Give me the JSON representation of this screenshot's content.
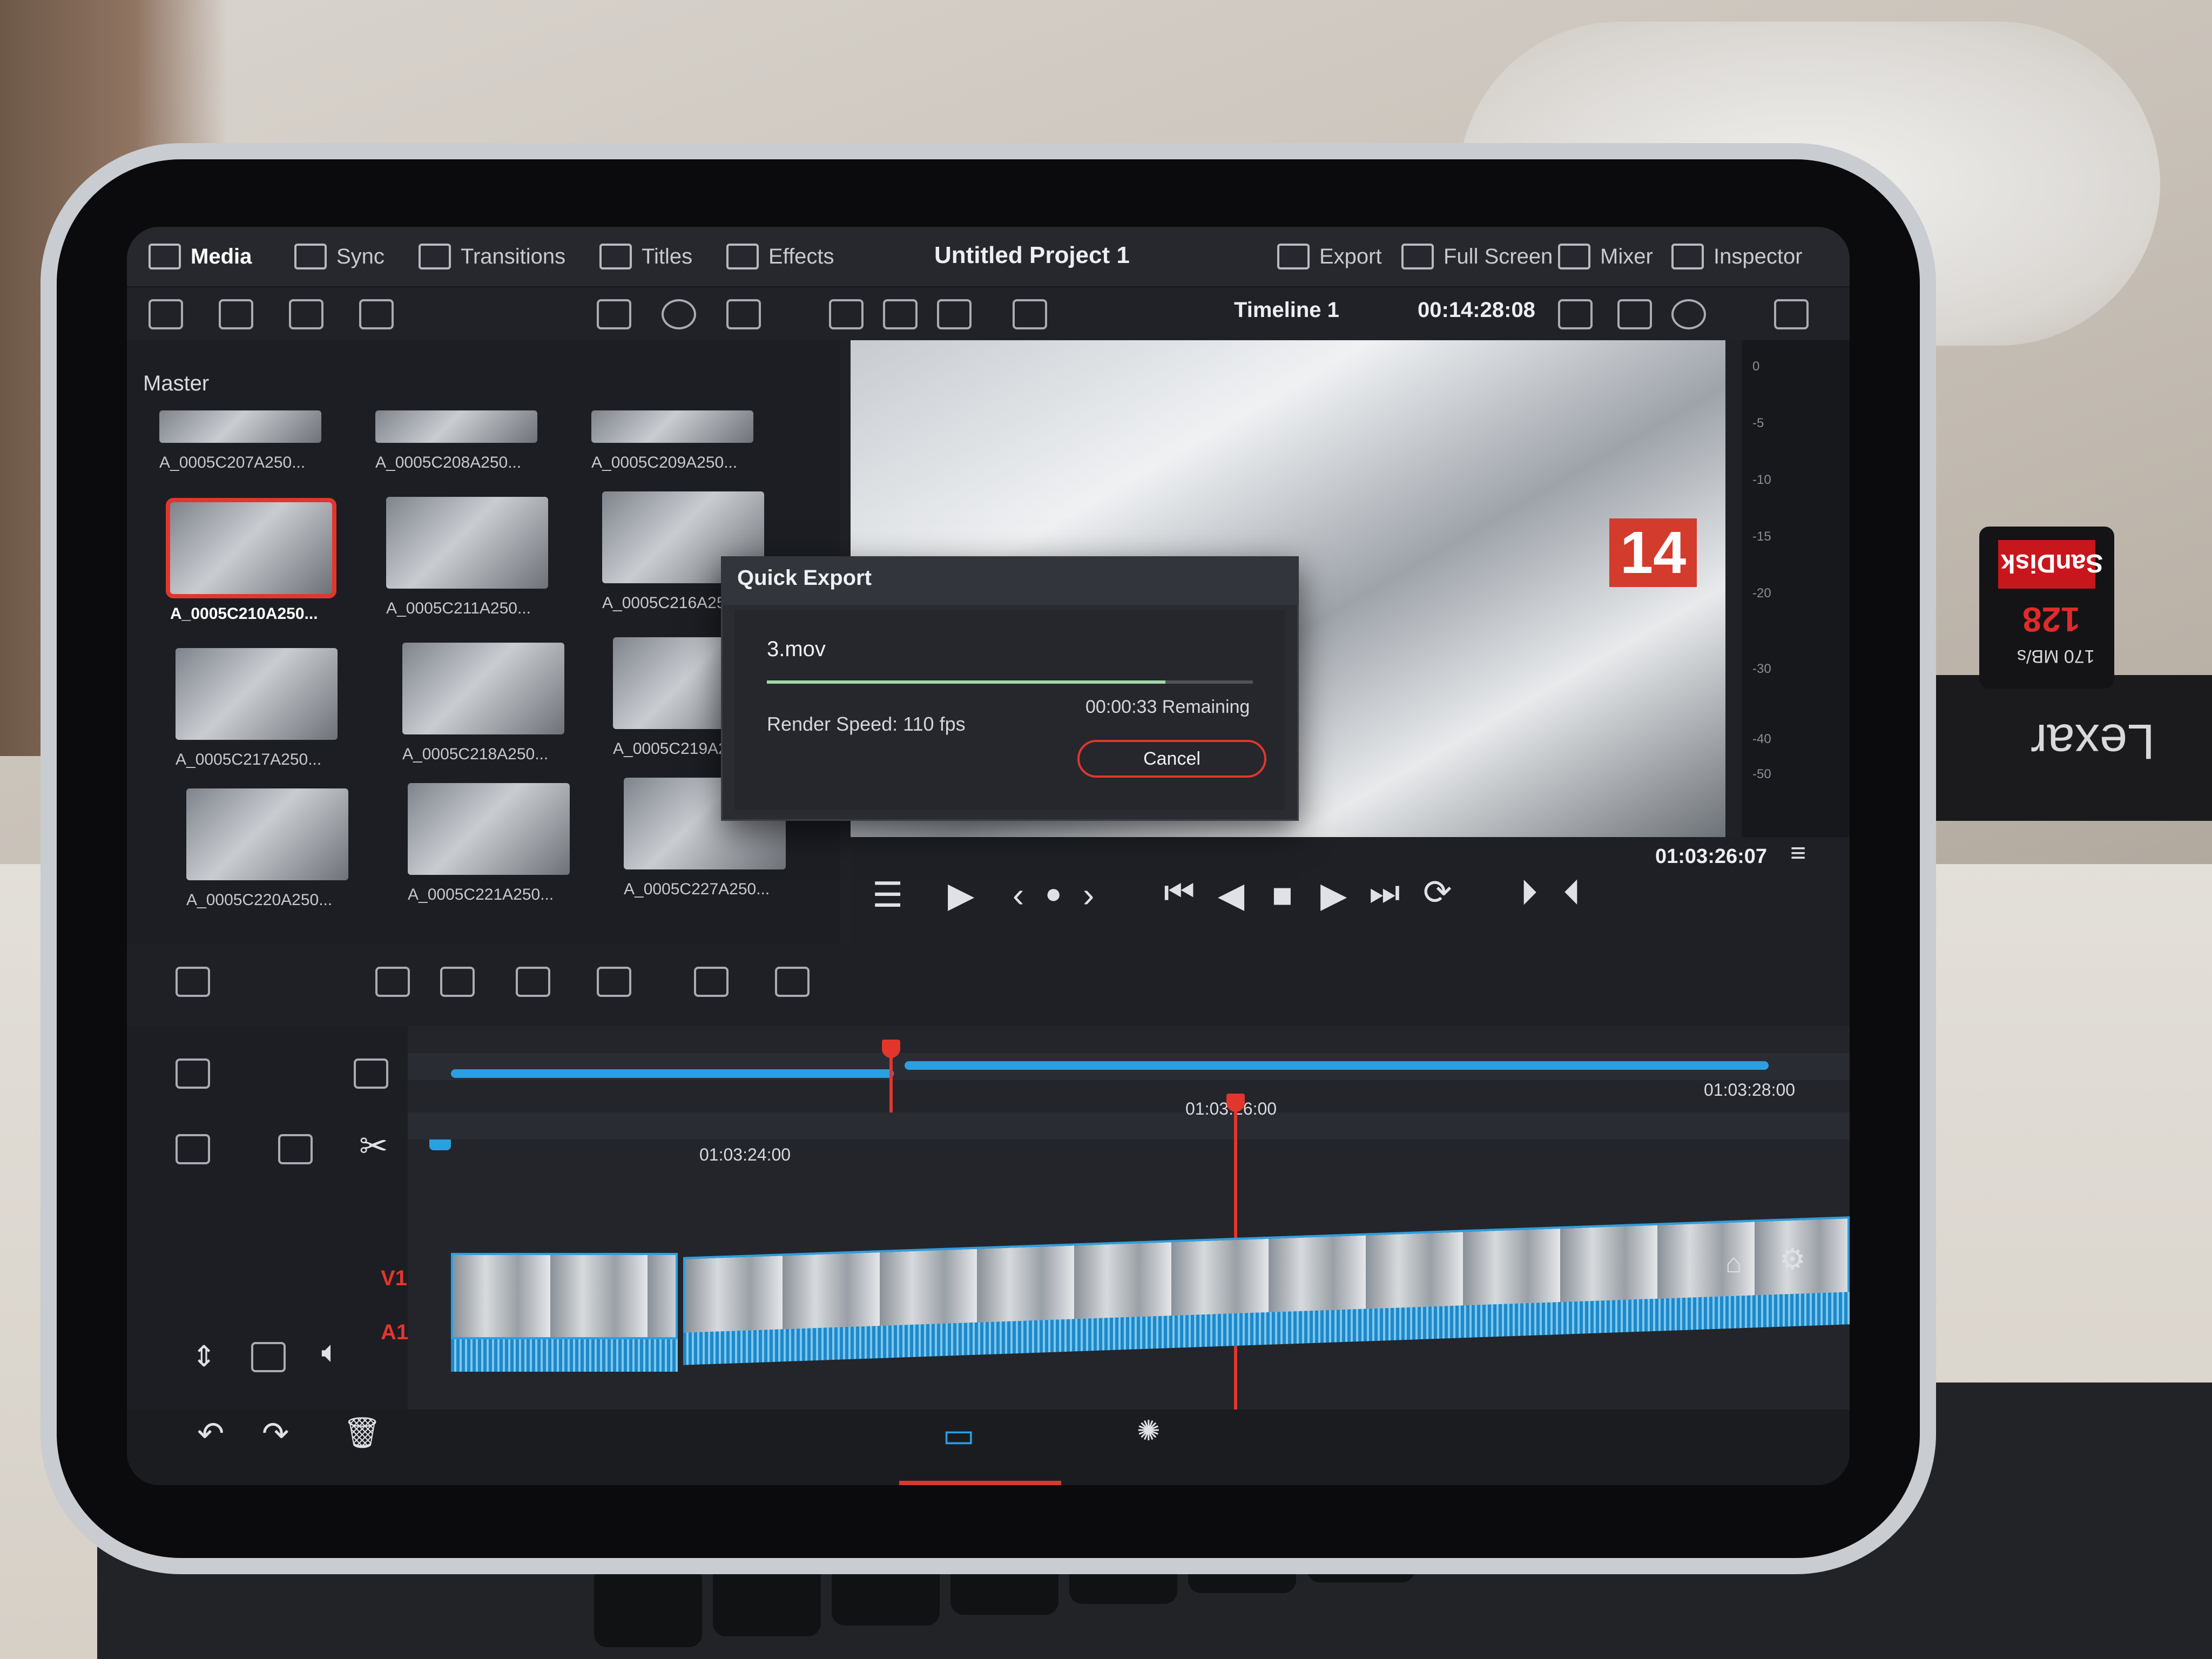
{
  "nav_tabs": [
    {
      "label": "Media",
      "icon": "media-icon"
    },
    {
      "label": "Sync",
      "icon": "sync-icon"
    },
    {
      "label": "Transitions",
      "icon": "transitions-icon"
    },
    {
      "label": "Titles",
      "icon": "titles-icon"
    },
    {
      "label": "Effects",
      "icon": "effects-icon"
    }
  ],
  "project_title": "Untitled Project 1",
  "right_tabs": [
    {
      "label": "Export",
      "icon": "export-icon"
    },
    {
      "label": "Full Screen",
      "icon": "fullscreen-icon"
    },
    {
      "label": "Mixer",
      "icon": "mixer-icon"
    },
    {
      "label": "Inspector",
      "icon": "inspector-icon"
    }
  ],
  "viewer": {
    "timeline_name": "Timeline 1",
    "timecode": "00:14:28:08",
    "player_timecode": "01:03:26:07",
    "car_number": "14"
  },
  "meter_labels": [
    "0",
    "-5",
    "-10",
    "-15",
    "-20",
    "-30",
    "-40",
    "-50"
  ],
  "media_pool": {
    "title": "Master",
    "clips": [
      {
        "label": "A_0005C207A250...",
        "selected": false
      },
      {
        "label": "A_0005C208A250...",
        "selected": false
      },
      {
        "label": "A_0005C209A250...",
        "selected": false
      },
      {
        "label": "A_0005C210A250...",
        "selected": true
      },
      {
        "label": "A_0005C211A250...",
        "selected": false
      },
      {
        "label": "A_0005C216A250...",
        "selected": false
      },
      {
        "label": "A_0005C217A250...",
        "selected": false
      },
      {
        "label": "A_0005C218A250...",
        "selected": false
      },
      {
        "label": "A_0005C219A250...",
        "selected": false
      },
      {
        "label": "A_0005C220A250...",
        "selected": false
      },
      {
        "label": "A_0005C221A250...",
        "selected": false
      },
      {
        "label": "A_0005C227A250...",
        "selected": false
      }
    ]
  },
  "quick_export": {
    "title": "Quick Export",
    "file_name": "3.mov",
    "progress": 0.82,
    "render_speed": "Render Speed: 110 fps",
    "remaining": "00:00:33 Remaining",
    "cancel_label": "Cancel"
  },
  "timeline": {
    "ruler_labels": [
      "01:03:28:00",
      "01:03:26:00",
      "01:03:24:00"
    ],
    "tracks": {
      "video": "V1",
      "audio": "A1"
    }
  },
  "hardware": {
    "sd_brand": "SanDisk",
    "sd_capacity": "128",
    "sd_speed": "170 MB/s",
    "reader_brand": "Lexar"
  },
  "colors": {
    "accent": "#e2362d",
    "timeline_blue": "#2c9fe0",
    "panel": "#1f2126"
  }
}
